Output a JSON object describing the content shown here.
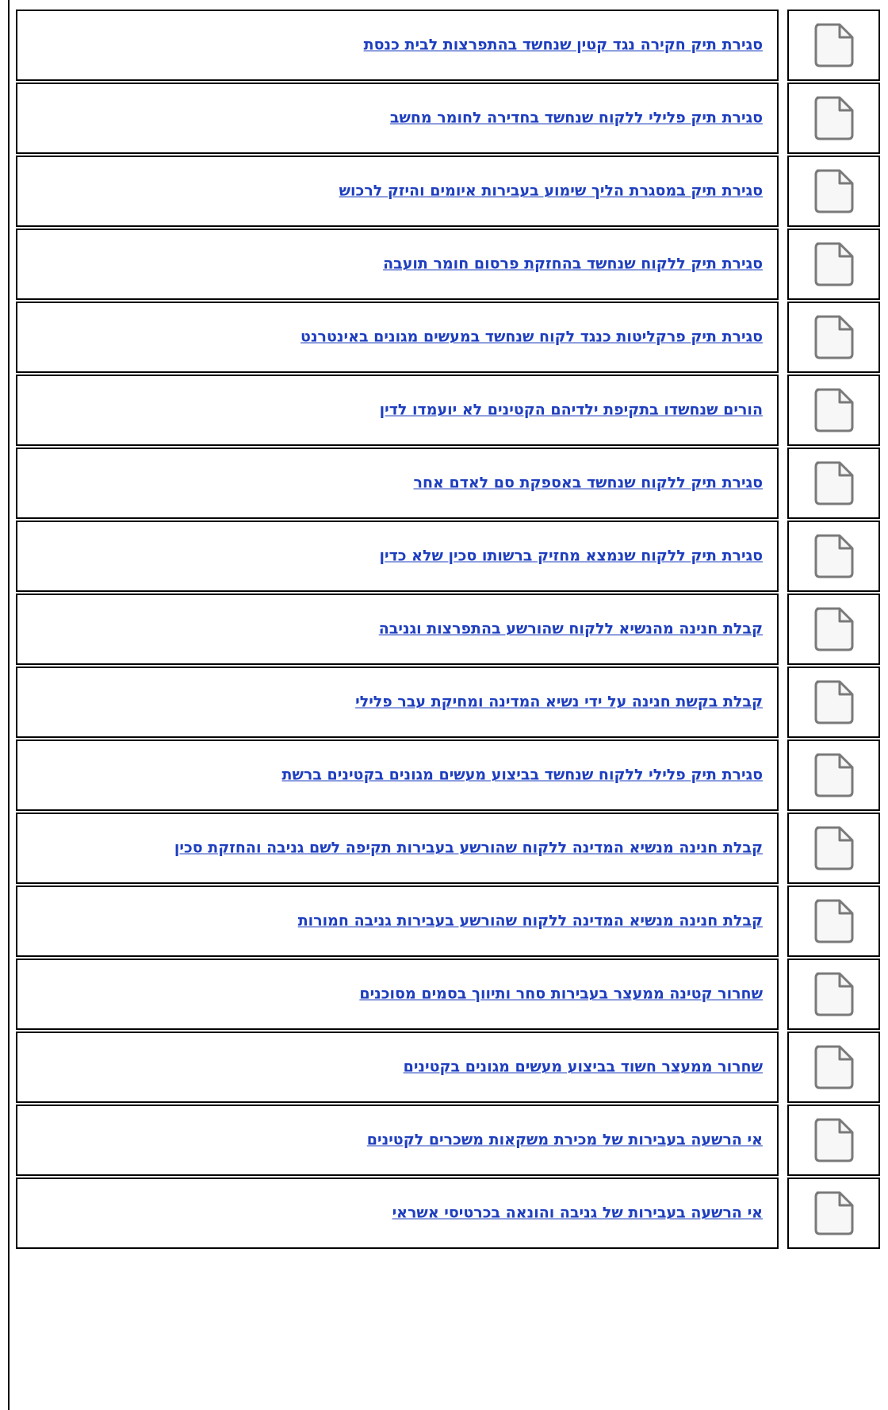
{
  "items": [
    {
      "title": "סגירת תיק חקירה נגד קטין שנחשד בהתפרצות לבית כנסת",
      "icon": "document-icon"
    },
    {
      "title": "סגירת תיק פלילי ללקוח שנחשד בחדירה לחומר מחשב",
      "icon": "document-icon"
    },
    {
      "title": "סגירת תיק במסגרת הליך שימוע בעבירות איומים והיזק לרכוש",
      "icon": "document-icon"
    },
    {
      "title": "סגירת תיק ללקוח שנחשד בהחזקת פרסום חומר תועבה",
      "icon": "document-icon"
    },
    {
      "title": "סגירת תיק פרקליטות כנגד לקוח שנחשד במעשים מגונים באינטרנט",
      "icon": "document-icon"
    },
    {
      "title": "הורים שנחשדו בתקיפת ילדיהם הקטינים לא יועמדו לדין",
      "icon": "document-icon"
    },
    {
      "title": "סגירת תיק ללקוח שנחשד באספקת סם לאדם אחר",
      "icon": "document-icon"
    },
    {
      "title": "סגירת תיק ללקוח שנמצא מחזיק ברשותו סכין שלא כדין",
      "icon": "document-icon"
    },
    {
      "title": "קבלת חנינה מהנשיא ללקוח שהורשע בהתפרצות וגניבה",
      "icon": "document-icon"
    },
    {
      "title": "קבלת בקשת חנינה על ידי נשיא המדינה ומחיקת עבר פלילי",
      "icon": "document-icon"
    },
    {
      "title": "סגירת תיק פלילי ללקוח שנחשד בביצוע מעשים מגונים בקטינים ברשת",
      "icon": "document-icon"
    },
    {
      "title": "קבלת חנינה מנשיא המדינה ללקוח שהורשע בעבירות תקיפה לשם גניבה והחזקת סכין",
      "icon": "document-icon"
    },
    {
      "title": "קבלת חנינה מנשיא המדינה ללקוח שהורשע בעבירות גניבה חמורות",
      "icon": "document-icon"
    },
    {
      "title": "שחרור קטינה ממעצר בעבירות סחר ותיווך בסמים מסוכנים",
      "icon": "document-icon"
    },
    {
      "title": "שחרור ממעצר חשוד בביצוע מעשים מגונים בקטינים",
      "icon": "document-icon"
    },
    {
      "title": "אי הרשעה בעבירות של מכירת משקאות משכרים לקטינים",
      "icon": "document-icon"
    },
    {
      "title": "אי הרשעה בעבירות של גניבה והונאה בכרטיסי אשראי",
      "icon": "document-icon"
    }
  ]
}
